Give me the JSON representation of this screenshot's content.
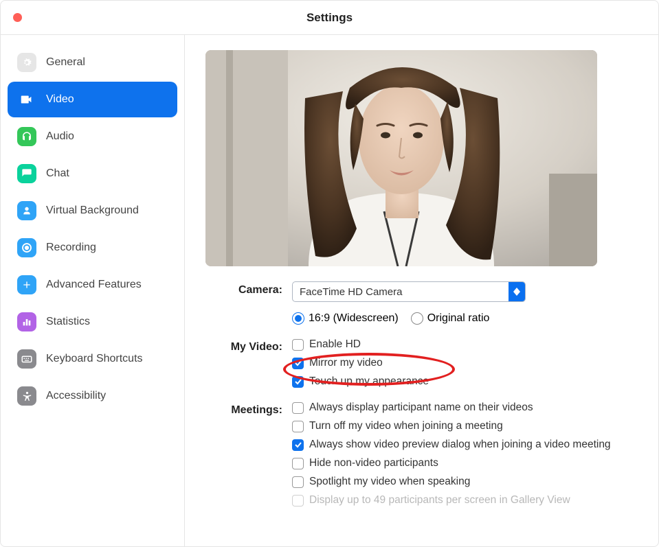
{
  "window": {
    "title": "Settings"
  },
  "sidebar": {
    "items": [
      {
        "label": "General",
        "icon": "gear",
        "color": "#e6e6e6"
      },
      {
        "label": "Video",
        "icon": "video",
        "color": "#ffffff",
        "active": true
      },
      {
        "label": "Audio",
        "icon": "headphones",
        "color": "#34c759"
      },
      {
        "label": "Chat",
        "icon": "chat",
        "color": "#0ad29c"
      },
      {
        "label": "Virtual Background",
        "icon": "person",
        "color": "#2fa4f7"
      },
      {
        "label": "Recording",
        "icon": "record",
        "color": "#2fa4f7"
      },
      {
        "label": "Advanced Features",
        "icon": "plus",
        "color": "#2fa4f7"
      },
      {
        "label": "Statistics",
        "icon": "stats",
        "color": "#b263e6"
      },
      {
        "label": "Keyboard Shortcuts",
        "icon": "keyboard",
        "color": "#8a8a8e"
      },
      {
        "label": "Accessibility",
        "icon": "accessibility",
        "color": "#8a8a8e"
      }
    ]
  },
  "settings": {
    "camera": {
      "label": "Camera:",
      "selected": "FaceTime HD Camera",
      "ratio": {
        "options": [
          {
            "label": "16:9 (Widescreen)",
            "selected": true
          },
          {
            "label": "Original ratio",
            "selected": false
          }
        ]
      }
    },
    "myVideo": {
      "label": "My Video:",
      "options": [
        {
          "label": "Enable HD",
          "checked": false
        },
        {
          "label": "Mirror my video",
          "checked": true
        },
        {
          "label": "Touch up my appearance",
          "checked": true,
          "highlighted": true
        }
      ]
    },
    "meetings": {
      "label": "Meetings:",
      "options": [
        {
          "label": "Always display participant name on their videos",
          "checked": false
        },
        {
          "label": "Turn off my video when joining a meeting",
          "checked": false
        },
        {
          "label": "Always show video preview dialog when joining a video meeting",
          "checked": true
        },
        {
          "label": "Hide non-video participants",
          "checked": false
        },
        {
          "label": "Spotlight my video when speaking",
          "checked": false
        },
        {
          "label": "Display up to 49 participants per screen in Gallery View",
          "checked": false,
          "disabled": true
        }
      ]
    }
  }
}
